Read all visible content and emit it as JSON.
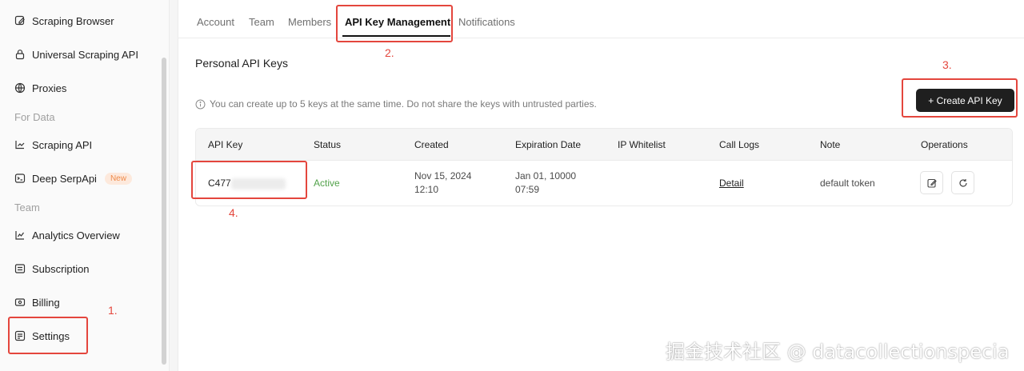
{
  "sidebar": {
    "items_top": [
      {
        "label": "Scraping Browser",
        "icon": "browser-edit-icon"
      },
      {
        "label": "Universal Scraping API",
        "icon": "lock-icon"
      },
      {
        "label": "Proxies",
        "icon": "globe-icon"
      }
    ],
    "section_data": "For Data",
    "items_data": [
      {
        "label": "Scraping API",
        "icon": "scrape-icon"
      },
      {
        "label": "Deep SerpApi",
        "icon": "terminal-icon",
        "badge": "New"
      }
    ],
    "section_team": "Team",
    "items_team": [
      {
        "label": "Analytics Overview",
        "icon": "chart-icon"
      },
      {
        "label": "Subscription",
        "icon": "list-icon"
      },
      {
        "label": "Billing",
        "icon": "billing-icon"
      },
      {
        "label": "Settings",
        "icon": "settings-icon"
      }
    ]
  },
  "tabs": [
    "Account",
    "Team",
    "Members",
    "API Key Management",
    "Notifications"
  ],
  "active_tab": "API Key Management",
  "section_title": "Personal API Keys",
  "info_text": "You can create up to 5 keys at the same time. Do not share the keys with untrusted parties.",
  "create_button": "+ Create API Key",
  "table": {
    "headers": [
      "API Key",
      "Status",
      "Created",
      "Expiration Date",
      "IP Whitelist",
      "Call Logs",
      "Note",
      "Operations"
    ],
    "row": {
      "api_key": "C477",
      "status": "Active",
      "created_line1": "Nov 15, 2024",
      "created_line2": "12:10",
      "expiration_line1": "Jan 01, 10000",
      "expiration_line2": "07:59",
      "ip_whitelist": "",
      "call_logs": "Detail",
      "note": "default token"
    }
  },
  "annotations": [
    "1.",
    "2.",
    "3.",
    "4."
  ],
  "watermark": "掘金技术社区 @ datacollectionspecia",
  "colors": {
    "accent_red": "#e4463d",
    "status_active": "#52a24a",
    "primary_button": "#1f1f1f"
  }
}
